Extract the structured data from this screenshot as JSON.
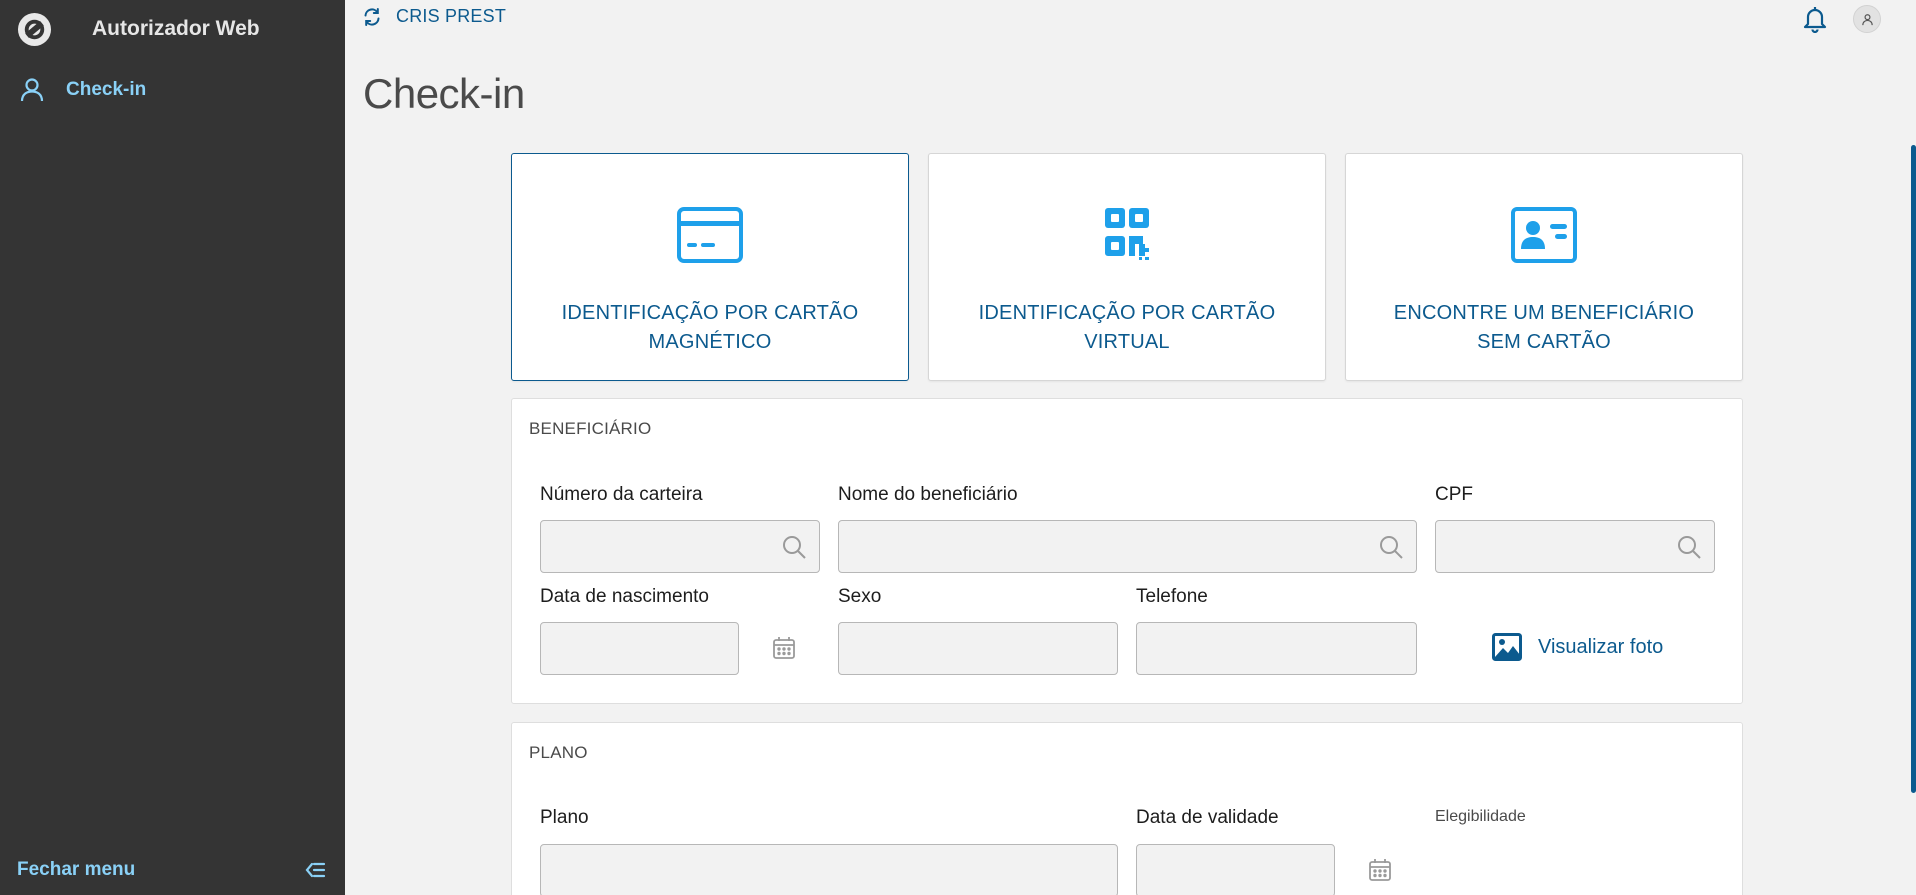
{
  "app": {
    "title": "Autorizador Web"
  },
  "sidebar": {
    "items": [
      {
        "label": "Check-in",
        "icon": "user-icon"
      }
    ],
    "footer_label": "Fechar menu"
  },
  "topbar": {
    "prestador": "CRIS PREST"
  },
  "page": {
    "title": "Check-in"
  },
  "cards": [
    {
      "label": "IDENTIFICAÇÃO POR CARTÃO MAGNÉTICO",
      "icon": "credit-card-icon",
      "selected": true
    },
    {
      "label": "IDENTIFICAÇÃO POR CARTÃO VIRTUAL",
      "icon": "qr-code-icon",
      "selected": false
    },
    {
      "label": "ENCONTRE UM BENEFICIÁRIO SEM CARTÃO",
      "icon": "id-card-icon",
      "selected": false
    }
  ],
  "beneficiario": {
    "title": "BENEFICIÁRIO",
    "fields": {
      "carteira": {
        "label": "Número da carteira",
        "value": ""
      },
      "nome": {
        "label": "Nome do beneficiário",
        "value": ""
      },
      "cpf": {
        "label": "CPF",
        "value": ""
      },
      "nascimento": {
        "label": "Data de nascimento",
        "value": ""
      },
      "sexo": {
        "label": "Sexo",
        "value": ""
      },
      "telefone": {
        "label": "Telefone",
        "value": ""
      }
    },
    "photo_link": "Visualizar foto"
  },
  "plano": {
    "title": "PLANO",
    "fields": {
      "plano": {
        "label": "Plano",
        "value": ""
      },
      "validade": {
        "label": "Data de validade",
        "value": ""
      }
    },
    "elegibilidade_label": "Elegibilidade"
  },
  "colors": {
    "sidebar_bg": "#343434",
    "accent": "#0c5a8e",
    "icon_blue": "#1ea0ea",
    "sidebar_active": "#8ad1f7"
  }
}
